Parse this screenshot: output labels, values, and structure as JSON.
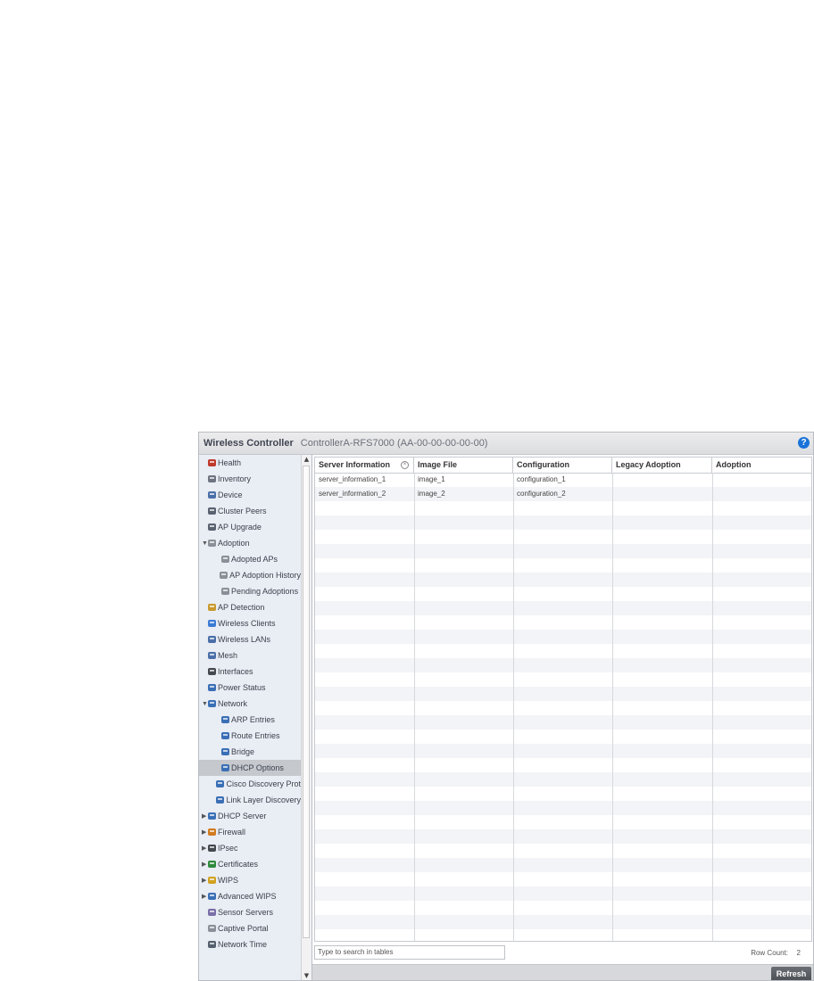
{
  "header": {
    "title": "Wireless Controller",
    "subtitle": "ControllerA-RFS7000 (AA-00-00-00-00-00)",
    "help": "?"
  },
  "sidebar": {
    "items": [
      {
        "label": "Health",
        "icon": "health-icon",
        "indent": 0,
        "arrow": ""
      },
      {
        "label": "Inventory",
        "icon": "inventory-icon",
        "indent": 0,
        "arrow": ""
      },
      {
        "label": "Device",
        "icon": "device-icon",
        "indent": 0,
        "arrow": ""
      },
      {
        "label": "Cluster Peers",
        "icon": "cluster-peers-icon",
        "indent": 0,
        "arrow": ""
      },
      {
        "label": "AP Upgrade",
        "icon": "ap-upgrade-icon",
        "indent": 0,
        "arrow": ""
      },
      {
        "label": "Adoption",
        "icon": "adoption-icon",
        "indent": 0,
        "arrow": "▼"
      },
      {
        "label": "Adopted APs",
        "icon": "adopted-aps-icon",
        "indent": 1,
        "arrow": ""
      },
      {
        "label": "AP Adoption History",
        "icon": "adoption-history-icon",
        "indent": 1,
        "arrow": ""
      },
      {
        "label": "Pending Adoptions",
        "icon": "pending-adoptions-icon",
        "indent": 1,
        "arrow": ""
      },
      {
        "label": "AP Detection",
        "icon": "ap-detection-icon",
        "indent": 0,
        "arrow": ""
      },
      {
        "label": "Wireless Clients",
        "icon": "wireless-clients-icon",
        "indent": 0,
        "arrow": ""
      },
      {
        "label": "Wireless LANs",
        "icon": "wireless-lans-icon",
        "indent": 0,
        "arrow": ""
      },
      {
        "label": "Mesh",
        "icon": "mesh-icon",
        "indent": 0,
        "arrow": ""
      },
      {
        "label": "Interfaces",
        "icon": "interfaces-icon",
        "indent": 0,
        "arrow": ""
      },
      {
        "label": "Power Status",
        "icon": "power-status-icon",
        "indent": 0,
        "arrow": ""
      },
      {
        "label": "Network",
        "icon": "network-icon",
        "indent": 0,
        "arrow": "▼"
      },
      {
        "label": "ARP Entries",
        "icon": "arp-entries-icon",
        "indent": 1,
        "arrow": ""
      },
      {
        "label": "Route Entries",
        "icon": "route-entries-icon",
        "indent": 1,
        "arrow": ""
      },
      {
        "label": "Bridge",
        "icon": "bridge-icon",
        "indent": 1,
        "arrow": ""
      },
      {
        "label": "DHCP Options",
        "icon": "dhcp-options-icon",
        "indent": 1,
        "arrow": "",
        "selected": true
      },
      {
        "label": "Cisco Discovery Prot",
        "icon": "cisco-discovery-icon",
        "indent": 1,
        "arrow": ""
      },
      {
        "label": "Link Layer Discovery",
        "icon": "link-layer-discovery-icon",
        "indent": 1,
        "arrow": ""
      },
      {
        "label": "DHCP Server",
        "icon": "dhcp-server-icon",
        "indent": 0,
        "arrow": "▶"
      },
      {
        "label": "Firewall",
        "icon": "firewall-icon",
        "indent": 0,
        "arrow": "▶"
      },
      {
        "label": "IPsec",
        "icon": "ipsec-icon",
        "indent": 0,
        "arrow": "▶"
      },
      {
        "label": "Certificates",
        "icon": "certificates-icon",
        "indent": 0,
        "arrow": "▶"
      },
      {
        "label": "WIPS",
        "icon": "wips-icon",
        "indent": 0,
        "arrow": "▶"
      },
      {
        "label": "Advanced WIPS",
        "icon": "advanced-wips-icon",
        "indent": 0,
        "arrow": "▶"
      },
      {
        "label": "Sensor Servers",
        "icon": "sensor-servers-icon",
        "indent": 0,
        "arrow": ""
      },
      {
        "label": "Captive Portal",
        "icon": "captive-portal-icon",
        "indent": 0,
        "arrow": ""
      },
      {
        "label": "Network Time",
        "icon": "network-time-icon",
        "indent": 0,
        "arrow": ""
      }
    ]
  },
  "table": {
    "columns": [
      "Server Information",
      "Image File",
      "Configuration",
      "Legacy Adoption",
      "Adoption"
    ],
    "rows": [
      [
        "server_information_1",
        "image_1",
        "configuration_1",
        "",
        ""
      ],
      [
        "server_information_2",
        "image_2",
        "configuration_2",
        "",
        ""
      ]
    ],
    "sort_icon": "sort-icon"
  },
  "footer": {
    "search_placeholder": "Type to search in tables",
    "row_count_label": "Row Count:",
    "row_count_value": "2",
    "refresh_label": "Refresh"
  }
}
